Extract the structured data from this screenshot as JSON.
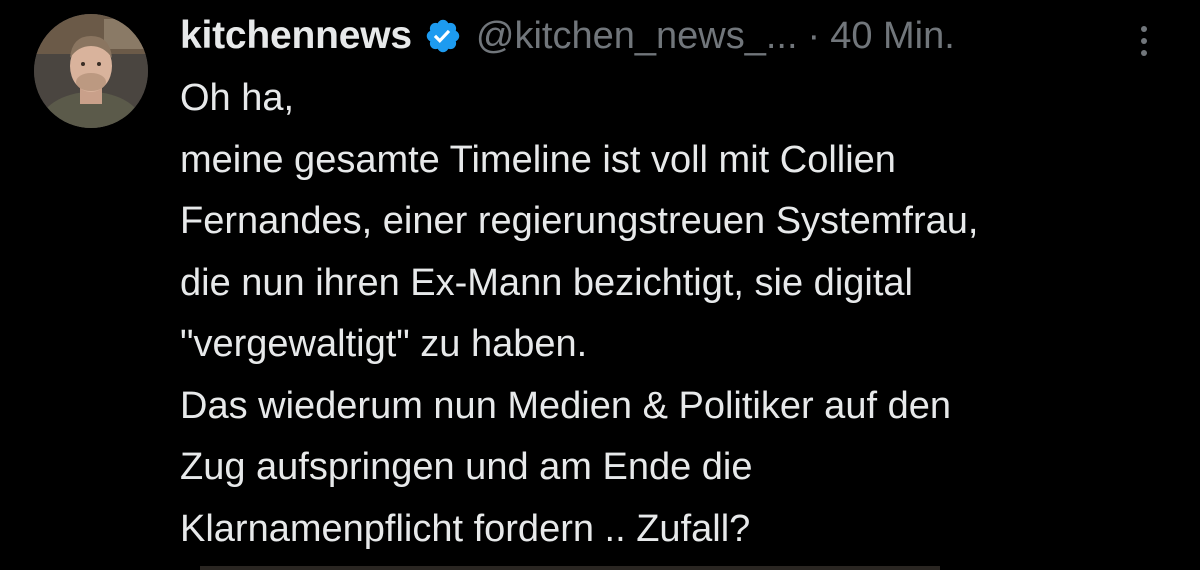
{
  "tweet": {
    "author": {
      "display_name": "kitchennews",
      "handle": "@kitchen_news_...",
      "verified": true,
      "avatar_icon": "profile-photo"
    },
    "separator": "·",
    "time": "40 Min.",
    "more_icon": "more-vertical-icon",
    "lines": [
      "Oh ha,",
      "meine gesamte Timeline ist voll mit Collien",
      "Fernandes, einer regierungstreuen Systemfrau,",
      "die nun ihren Ex-Mann bezichtigt, sie digital",
      "\"vergewaltigt\" zu haben.",
      "Das wiederum nun Medien & Politiker auf den",
      "Zug aufspringen und am Ende die",
      "Klarnamenpflicht fordern .. Zufall?"
    ]
  },
  "colors": {
    "background": "#000000",
    "text": "#e7e9ea",
    "secondary": "#71767b",
    "verified_badge": "#1d9bf0"
  }
}
